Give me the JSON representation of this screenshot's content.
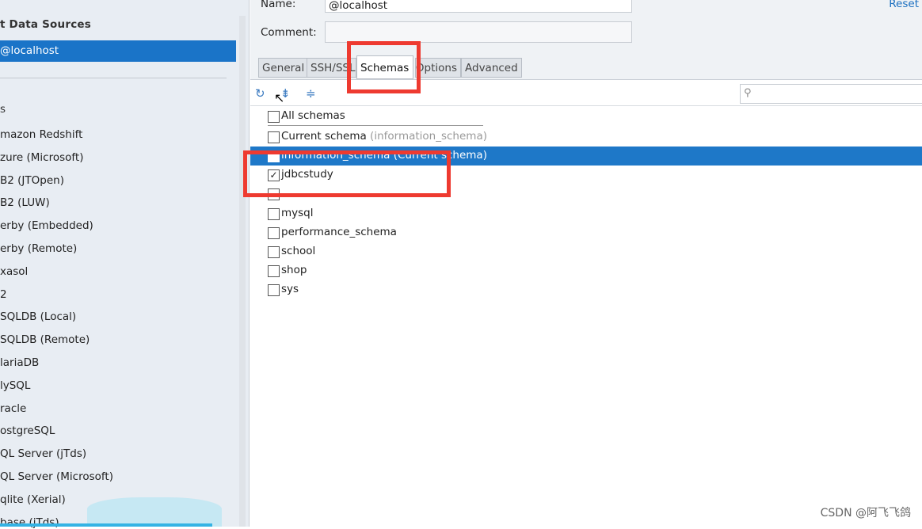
{
  "sidebar": {
    "title": "t Data Sources",
    "selected": "@localhost",
    "section": "s",
    "items": [
      "mazon Redshift",
      "zure (Microsoft)",
      "B2 (JTOpen)",
      "B2 (LUW)",
      "erby (Embedded)",
      "erby (Remote)",
      "xasol",
      "2",
      "SQLDB (Local)",
      "SQLDB (Remote)",
      "lariaDB",
      "lySQL",
      "racle",
      "ostgreSQL",
      "QL Server (jTds)",
      "QL Server (Microsoft)",
      "qlite (Xerial)",
      "base (jTds)"
    ]
  },
  "form": {
    "name_label": "Name:",
    "name_value": "@localhost",
    "comment_label": "Comment:",
    "comment_value": "",
    "reset_label": "Reset"
  },
  "tabs": [
    {
      "label": "General"
    },
    {
      "label": "SSH/SSL"
    },
    {
      "label": "Schemas",
      "active": true
    },
    {
      "label": "Options"
    },
    {
      "label": "Advanced"
    }
  ],
  "toolbar": {
    "icons": [
      "refresh-icon",
      "expand-all-icon",
      "collapse-all-icon"
    ],
    "search_placeholder": ""
  },
  "schemas": {
    "all": {
      "label": "All schemas",
      "checked": false
    },
    "current": {
      "label": "Current schema",
      "hint": "(information_schema)",
      "checked": false
    },
    "items": [
      {
        "label": "information_schema",
        "hint": "(Current schema)",
        "checked": false,
        "selected": true
      },
      {
        "label": "jdbcstudy",
        "checked": true
      },
      {
        "label": "",
        "checked": false
      },
      {
        "label": "mysql",
        "checked": false
      },
      {
        "label": "performance_schema",
        "checked": false
      },
      {
        "label": "school",
        "checked": false
      },
      {
        "label": "shop",
        "checked": false
      },
      {
        "label": "sys",
        "checked": false
      }
    ]
  },
  "watermark": "CSDN @阿飞飞鸽",
  "colors": {
    "selection": "#1e78c8",
    "highlight_box": "#ee3a30"
  }
}
